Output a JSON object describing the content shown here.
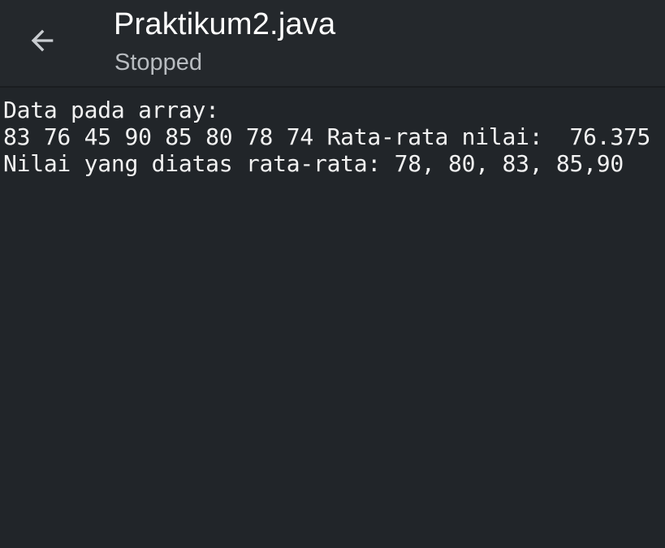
{
  "header": {
    "back_icon": "arrow-left-icon",
    "title": "Praktikum2.java",
    "status": "Stopped"
  },
  "console": {
    "lines": [
      "Data pada array:",
      "83 76 45 90 85 80 78 74 Rata-rata nilai:  76.375",
      "Nilai yang diatas rata-rata: 78, 80, 83, 85,90"
    ]
  },
  "colors": {
    "background": "#212529",
    "header_background": "#24282c",
    "title_text": "#ffffff",
    "status_text": "#b8bcc0",
    "console_text": "#f2f2f2"
  }
}
